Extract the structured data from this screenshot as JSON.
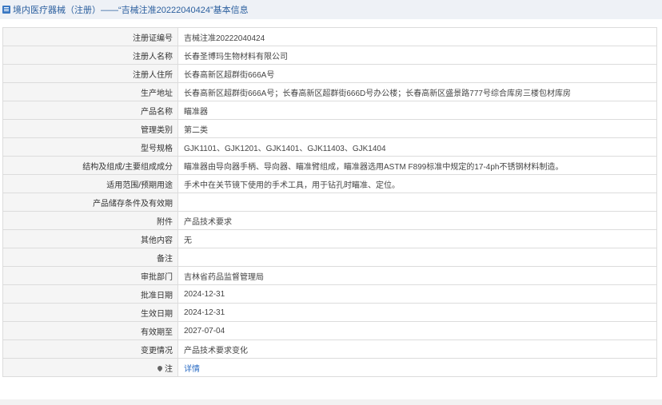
{
  "header": {
    "title": "境内医疗器械（注册）——“吉械注准20222040424”基本信息",
    "icon": "list-icon"
  },
  "rows": [
    {
      "label": "注册证编号",
      "value": "吉械注准20222040424"
    },
    {
      "label": "注册人名称",
      "value": "长春圣博玛生物材料有限公司"
    },
    {
      "label": "注册人住所",
      "value": "长春高新区超群街666A号"
    },
    {
      "label": "生产地址",
      "value": "长春高新区超群街666A号；长春高新区超群街666D号办公楼；长春高新区盛景路777号综合库房三楼包材库房"
    },
    {
      "label": "产品名称",
      "value": "瞄准器"
    },
    {
      "label": "管理类别",
      "value": "第二类"
    },
    {
      "label": "型号规格",
      "value": "GJK1101、GJK1201、GJK1401、GJK11403、GJK1404"
    },
    {
      "label": "结构及组成/主要组成成分",
      "value": "瞄准器由导向器手柄、导向器、瞄准臂组成，瞄准器选用ASTM F899标准中规定的17-4ph不锈钢材料制造。"
    },
    {
      "label": "适用范围/预期用途",
      "value": "手术中在关节镜下使用的手术工具，用于钻孔时瞄准、定位。"
    },
    {
      "label": "产品储存条件及有效期",
      "value": ""
    },
    {
      "label": "附件",
      "value": "产品技术要求"
    },
    {
      "label": "其他内容",
      "value": "无"
    },
    {
      "label": "备注",
      "value": ""
    },
    {
      "label": "审批部门",
      "value": "吉林省药品监督管理局"
    },
    {
      "label": "批准日期",
      "value": "2024-12-31"
    },
    {
      "label": "生效日期",
      "value": "2024-12-31"
    },
    {
      "label": "有效期至",
      "value": "2027-07-04"
    },
    {
      "label": "变更情况",
      "value": "产品技术要求变化"
    }
  ],
  "note_row": {
    "label": "注",
    "value": "详情",
    "icon": "pin-icon"
  },
  "colors": {
    "header_bg": "#eef1f6",
    "header_text": "#2b5f9e",
    "label_bg": "#f5f5f5",
    "border": "#dcdcdc",
    "link": "#2b6cc4"
  }
}
